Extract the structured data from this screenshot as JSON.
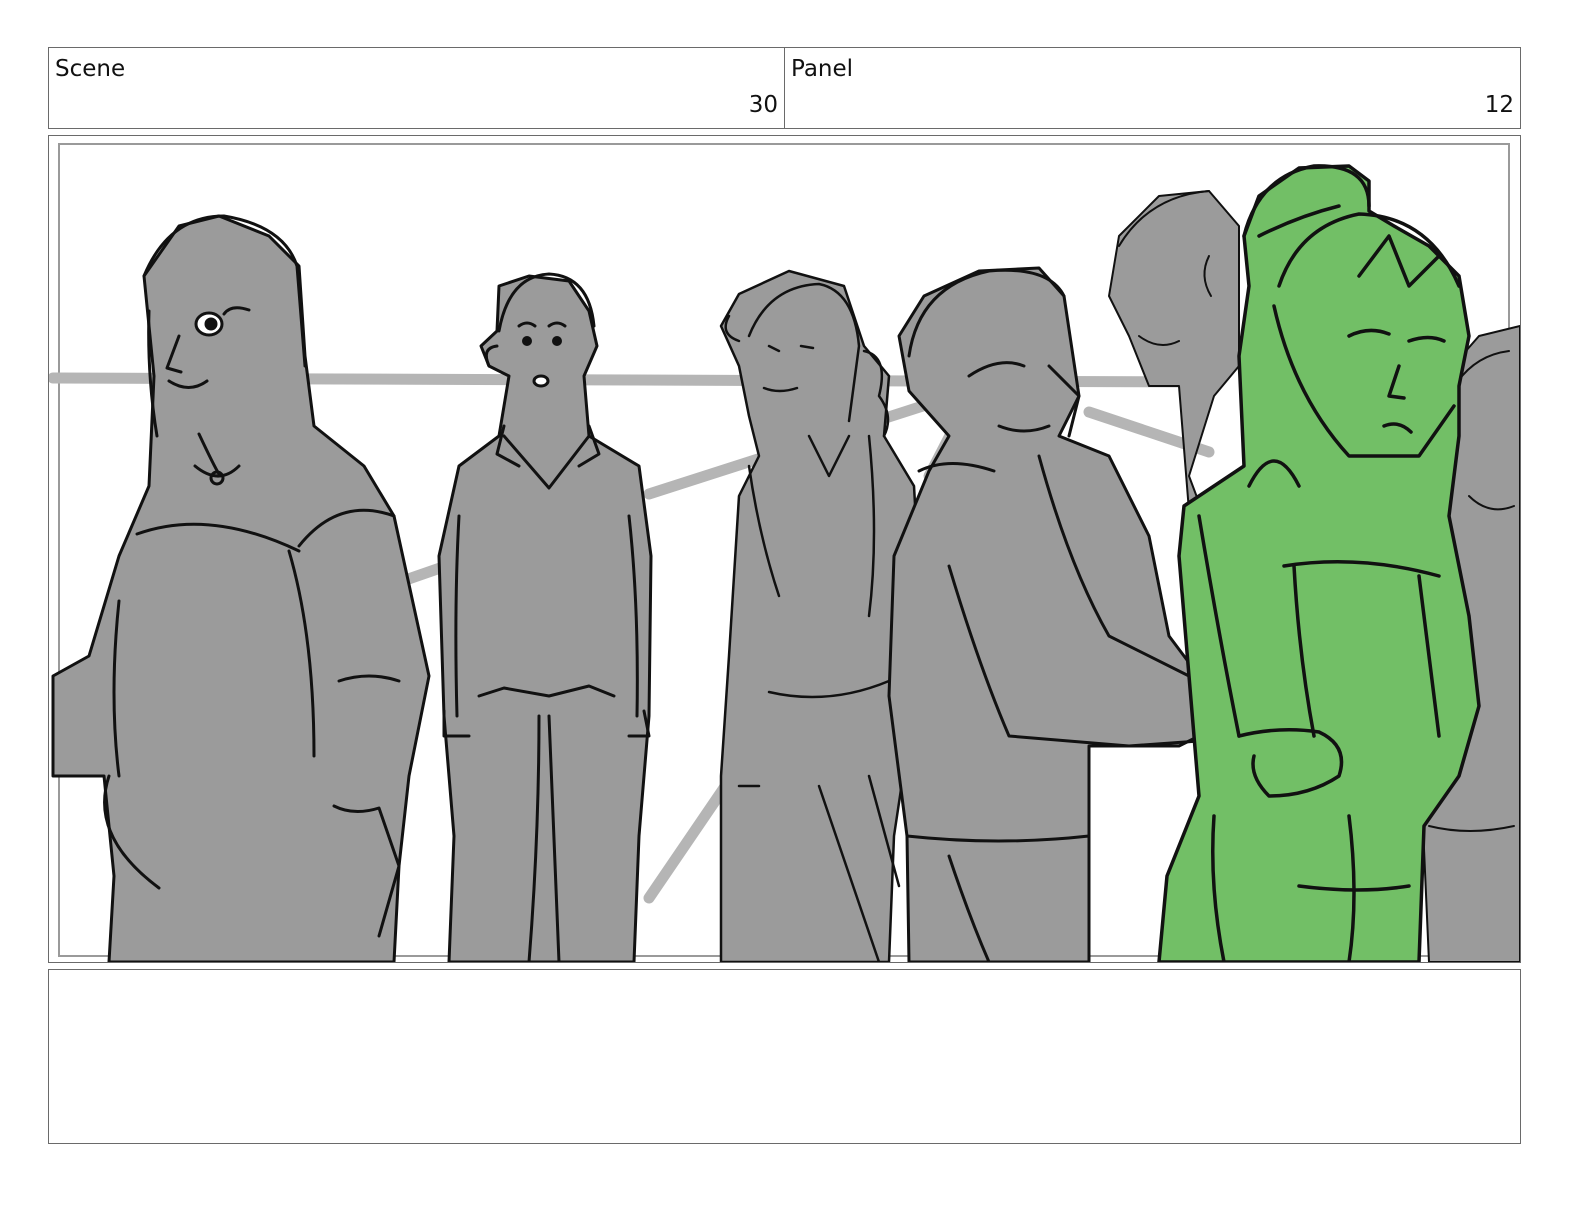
{
  "header": {
    "scene_label": "Scene",
    "scene_number": "30",
    "panel_label": "Panel",
    "panel_number": "12"
  },
  "drawing": {
    "figure_fill": "#9b9b9b",
    "highlight_fill": "#72bf66",
    "line_color": "#111111",
    "background_line_color": "#b5b5b5"
  },
  "notes": {
    "text": ""
  }
}
